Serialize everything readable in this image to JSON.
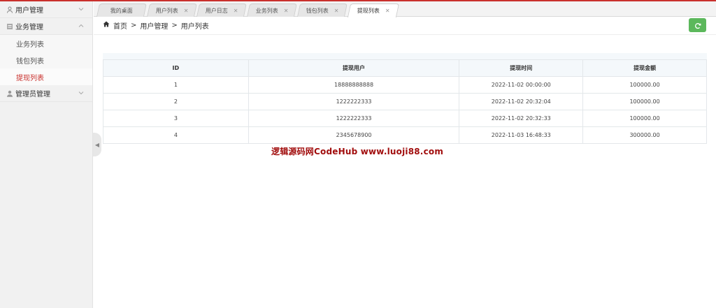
{
  "sidebar": {
    "groups": [
      {
        "label": "用户管理",
        "icon": "user-icon"
      },
      {
        "label": "业务管理",
        "icon": "list-icon"
      },
      {
        "label": "管理员管理",
        "icon": "admin-user-icon"
      }
    ],
    "sub_items": [
      {
        "label": "业务列表"
      },
      {
        "label": "钱包列表"
      },
      {
        "label": "提现列表",
        "active": true
      }
    ]
  },
  "tabs": [
    {
      "label": "我的桌面",
      "closable": false
    },
    {
      "label": "用户列表",
      "closable": true
    },
    {
      "label": "用户日志",
      "closable": true
    },
    {
      "label": "业务列表",
      "closable": true
    },
    {
      "label": "钱包列表",
      "closable": true
    },
    {
      "label": "提现列表",
      "closable": true,
      "active": true
    }
  ],
  "breadcrumb": {
    "home": "首页",
    "sep": ">",
    "level1": "用户管理",
    "level2": "用户列表"
  },
  "table": {
    "headers": [
      "ID",
      "提现用户",
      "提现时间",
      "提现金额"
    ],
    "rows": [
      [
        "1",
        "18888888888",
        "2022-11-02 00:00:00",
        "100000.00"
      ],
      [
        "2",
        "1222222333",
        "2022-11-02 20:32:04",
        "100000.00"
      ],
      [
        "3",
        "1222222333",
        "2022-11-02 20:32:33",
        "100000.00"
      ],
      [
        "4",
        "2345678900",
        "2022-11-03 16:48:33",
        "300000.00"
      ]
    ]
  },
  "watermark": "逻辑源码网CodeHub  www.luoji88.com",
  "colors": {
    "accent": "#c9302c",
    "refresh_button": "#5cb85c",
    "table_header": "#f4f8fb"
  }
}
